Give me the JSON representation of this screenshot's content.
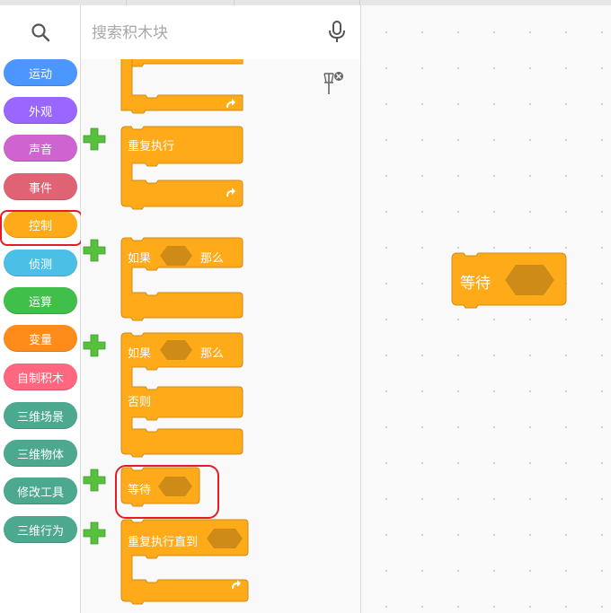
{
  "search": {
    "placeholder": "搜索积木块"
  },
  "categories": [
    {
      "label": "运动",
      "color": "#4c97ff"
    },
    {
      "label": "外观",
      "color": "#9966ff"
    },
    {
      "label": "声音",
      "color": "#cf63cf"
    },
    {
      "label": "事件",
      "color": "#e06374"
    },
    {
      "label": "控制",
      "color": "#ffab19"
    },
    {
      "label": "侦测",
      "color": "#4cbfe6"
    },
    {
      "label": "运算",
      "color": "#40bf4a"
    },
    {
      "label": "变量",
      "color": "#ff8c1a"
    },
    {
      "label": "自制积木",
      "color": "#ff6680"
    },
    {
      "label": "三维场景",
      "color": "#4ca88f"
    },
    {
      "label": "三维物体",
      "color": "#4ca88f"
    },
    {
      "label": "修改工具",
      "color": "#4ca88f"
    },
    {
      "label": "三维行为",
      "color": "#4ca88f"
    }
  ],
  "selected_category": "控制",
  "blocks": {
    "repeat": "重复执行",
    "if_label": "如果",
    "then_label": "那么",
    "else_label": "否则",
    "wait": "等待",
    "repeat_until": "重复执行直到"
  },
  "workspace": {
    "wait_block": "等待"
  },
  "colors": {
    "control": "#ffab19",
    "control_dark": "#cf8b17",
    "hexagon": "#cf8b17",
    "highlight": "#e21d25",
    "plus_green": "#57c13d"
  }
}
